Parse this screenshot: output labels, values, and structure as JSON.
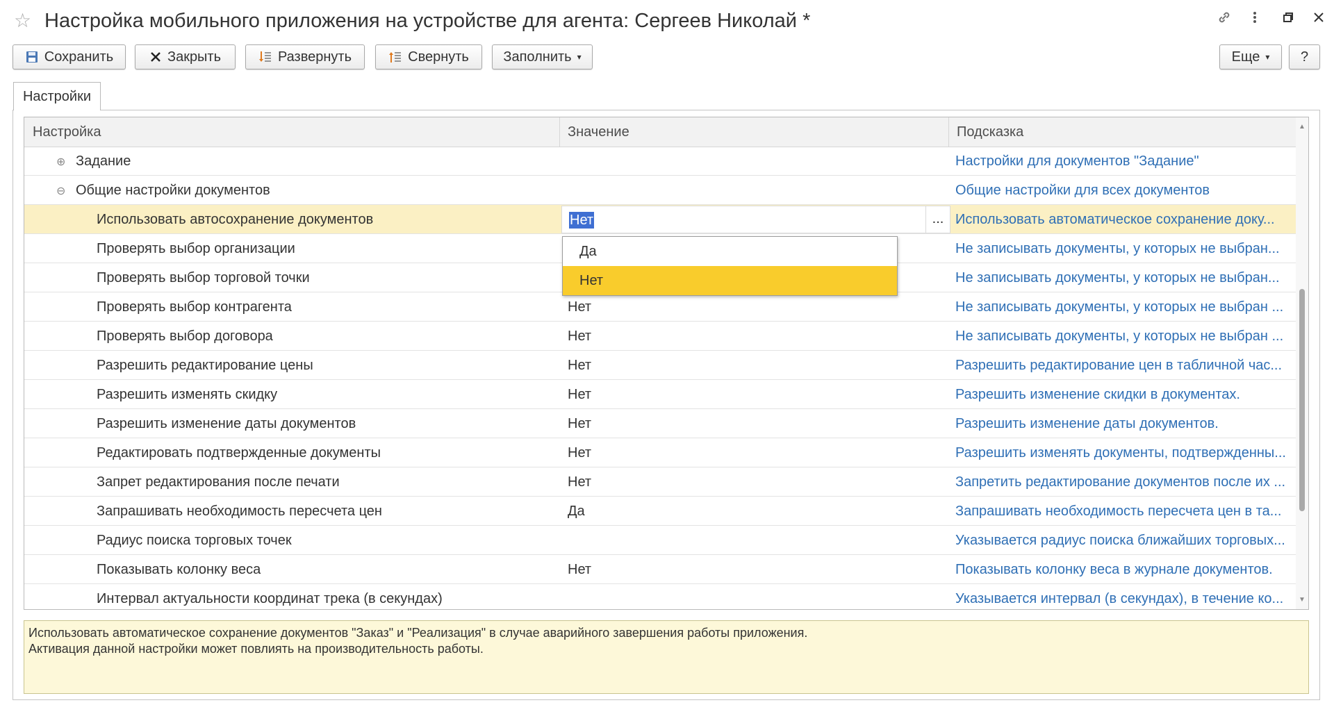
{
  "window": {
    "title": "Настройка мобильного приложения на устройстве для агента: Сергеев Николай *",
    "icons": [
      "star-icon",
      "link-icon",
      "more-vertical-icon",
      "restore-window-icon",
      "close-icon"
    ]
  },
  "toolbar": {
    "save": "Сохранить",
    "close": "Закрыть",
    "expand": "Развернуть",
    "collapse": "Свернуть",
    "fill": "Заполнить",
    "more": "Еще",
    "help": "?"
  },
  "tabs": [
    {
      "label": "Настройки"
    }
  ],
  "grid": {
    "columns": [
      "Настройка",
      "Значение",
      "Подсказка"
    ],
    "rows": [
      {
        "name": "Задание",
        "value": "",
        "hint": "Настройки для документов \"Задание\"",
        "group": "collapsed"
      },
      {
        "name": "Общие настройки документов",
        "value": "",
        "hint": "Общие настройки для всех документов",
        "group": "expanded"
      },
      {
        "name": "Использовать автосохранение документов",
        "value": "Нет",
        "hint": "Использовать автоматическое сохранение доку...",
        "selected": true
      },
      {
        "name": "Проверять выбор организации",
        "value": "",
        "hint": "Не записывать документы, у которых не выбран..."
      },
      {
        "name": "Проверять выбор торговой точки",
        "value": "",
        "hint": "Не записывать документы, у которых не выбран..."
      },
      {
        "name": "Проверять выбор контрагента",
        "value": "Нет",
        "hint": "Не записывать документы, у которых не выбран ..."
      },
      {
        "name": "Проверять выбор договора",
        "value": "Нет",
        "hint": "Не записывать документы, у которых не выбран ..."
      },
      {
        "name": "Разрешить редактирование цены",
        "value": "Нет",
        "hint": "Разрешить редактирование цен в табличной час..."
      },
      {
        "name": "Разрешить изменять скидку",
        "value": "Нет",
        "hint": "Разрешить изменение скидки в документах."
      },
      {
        "name": "Разрешить изменение даты документов",
        "value": "Нет",
        "hint": "Разрешить изменение даты документов."
      },
      {
        "name": "Редактировать подтвержденные документы",
        "value": "Нет",
        "hint": "Разрешить изменять документы, подтвержденны..."
      },
      {
        "name": "Запрет редактирования после печати",
        "value": "Нет",
        "hint": "Запретить редактирование документов после их ..."
      },
      {
        "name": "Запрашивать необходимость пересчета цен",
        "value": "Да",
        "hint": "Запрашивать необходимость пересчета цен в та..."
      },
      {
        "name": "Радиус поиска торговых точек",
        "value": "",
        "hint": "Указывается радиус поиска ближайших торговых..."
      },
      {
        "name": "Показывать колонку веса",
        "value": "Нет",
        "hint": "Показывать колонку веса в журнале документов."
      },
      {
        "name": "Интервал актуальности координат трека (в секундах)",
        "value": "",
        "hint": "Указывается интервал (в секундах), в течение ко..."
      }
    ]
  },
  "editor": {
    "value": "Нет",
    "select_button": "...",
    "options": [
      "Да",
      "Нет"
    ],
    "highlighted": "Нет"
  },
  "hint_panel": {
    "line1": "Использовать автоматическое сохранение документов \"Заказ\" и \"Реализация\" в случае аварийного завершения работы приложения.",
    "line2": "Активация данной настройки может повлиять на производительность работы."
  },
  "colors": {
    "selected_row": "#fbf0c4",
    "dropdown_highlight": "#f9cc2c",
    "hint_link": "#2f6fb5",
    "hint_panel_bg": "#fdf8d9"
  }
}
